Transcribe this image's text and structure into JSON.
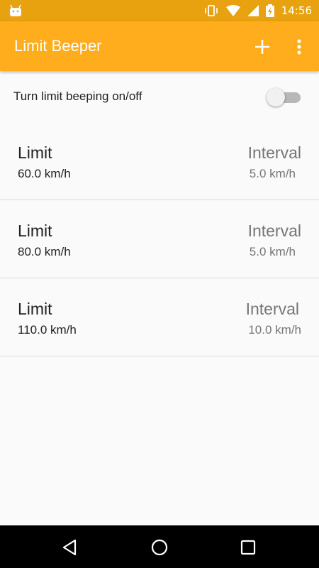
{
  "status_bar": {
    "time": "14:56",
    "left_icon": "android-icon",
    "icons": [
      "vibrate-icon",
      "wifi-icon",
      "signal-icon",
      "battery-charging-icon"
    ]
  },
  "toolbar": {
    "title": "Limit Beeper",
    "add_icon": "plus-icon",
    "menu_icon": "overflow-menu-icon",
    "color": "#ffac1d"
  },
  "toggle": {
    "label": "Turn limit beeping on/off",
    "state": "off"
  },
  "limits": [
    {
      "limit_label": "Limit",
      "limit_value": "60.0 km/h",
      "interval_label": "Interval",
      "interval_value": "5.0 km/h"
    },
    {
      "limit_label": "Limit",
      "limit_value": "80.0 km/h",
      "interval_label": "Interval",
      "interval_value": "5.0 km/h"
    },
    {
      "limit_label": "Limit",
      "limit_value": "110.0 km/h",
      "interval_label": "Interval",
      "interval_value": "10.0 km/h"
    }
  ],
  "nav_bar": {
    "icons": [
      "back-icon",
      "home-icon",
      "recents-icon"
    ]
  }
}
